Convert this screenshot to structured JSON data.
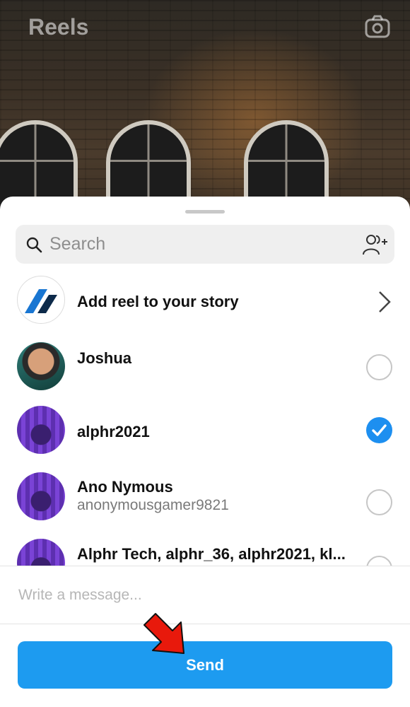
{
  "header": {
    "title": "Reels",
    "camera_icon": "camera-icon"
  },
  "search": {
    "placeholder": "Search",
    "icon": "search-icon",
    "add_people_icon": "add-people-icon"
  },
  "story_row": {
    "label": "Add reel to your story",
    "icon": "chevron-right-icon"
  },
  "contacts": [
    {
      "name": "Joshua",
      "username": "",
      "selected": false
    },
    {
      "name": "alphr2021",
      "username": "",
      "selected": true
    },
    {
      "name": "Ano Nymous",
      "username": "anonymousgamer9821",
      "selected": false
    },
    {
      "name": "Alphr Tech, alphr_36, alphr2021, kl...",
      "username": "",
      "selected": false
    }
  ],
  "message": {
    "placeholder": "Write a message..."
  },
  "send": {
    "label": "Send"
  },
  "colors": {
    "accent": "#1d9bf0",
    "check": "#1d8ff0",
    "annotation_arrow": "#e8190c"
  }
}
